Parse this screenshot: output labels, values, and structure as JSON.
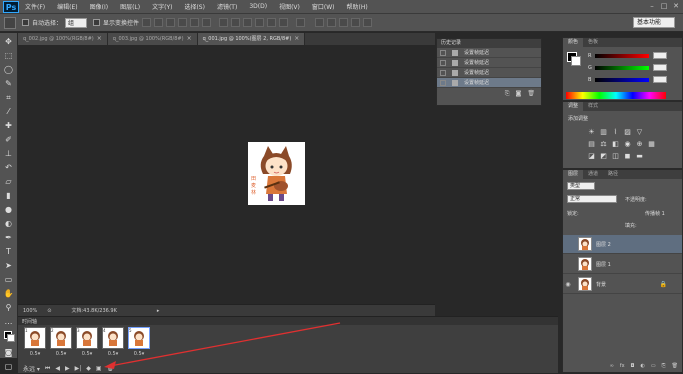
{
  "menu": [
    "文件(F)",
    "编辑(E)",
    "图像(I)",
    "图层(L)",
    "文字(Y)",
    "选择(S)",
    "滤镜(T)",
    "3D(D)",
    "视图(V)",
    "窗口(W)",
    "帮助(H)"
  ],
  "options": {
    "auto_select_label": "自动选择：",
    "auto_select_value": "组",
    "transform_label": "显示变换控件",
    "workspace": "基本功能"
  },
  "tabs": [
    {
      "label": "q_002.jpg @ 100%(RGB/8#)",
      "active": false
    },
    {
      "label": "q_003.jpg @ 100%(RGB/8#)",
      "active": false
    },
    {
      "label": "q_001.jpg @ 100%(图层 2, RGB/8#)",
      "active": true
    }
  ],
  "status": {
    "zoom": "100%",
    "doc": "文档:43.8K/236.9K"
  },
  "timeline": {
    "title": "时间轴",
    "frames": [
      {
        "num": "1",
        "time": "0.5▾"
      },
      {
        "num": "2",
        "time": "0.5▾"
      },
      {
        "num": "3",
        "time": "0.5▾"
      },
      {
        "num": "4",
        "time": "0.5▾"
      },
      {
        "num": "5",
        "time": "0.5▾"
      }
    ],
    "loop": "永远 ▾"
  },
  "history": {
    "title": "历史记录",
    "rows": [
      "设置帧延迟",
      "设置帧延迟",
      "设置帧延迟",
      "设置帧延迟"
    ]
  },
  "color_panel": {
    "tabs": [
      "颜色",
      "色板"
    ],
    "labels": [
      "R",
      "G",
      "B"
    ]
  },
  "adjust": {
    "tabs": [
      "调整",
      "样式"
    ],
    "title": "添加调整"
  },
  "layers": {
    "tabs": [
      "图层",
      "通道",
      "路径"
    ],
    "kind": "类型",
    "blend": "正常",
    "opacity_label": "不透明度:",
    "lock_label": "锁定:",
    "unify_label": "传播帧 1",
    "fill_label": "填充:",
    "rows": [
      {
        "name": "图层 2",
        "selected": true
      },
      {
        "name": "图层 1",
        "selected": false
      },
      {
        "name": "背景",
        "selected": false
      }
    ]
  },
  "colors": {
    "accent": "#31a8ff",
    "arrow": "#e03030",
    "panel": "#535353"
  }
}
